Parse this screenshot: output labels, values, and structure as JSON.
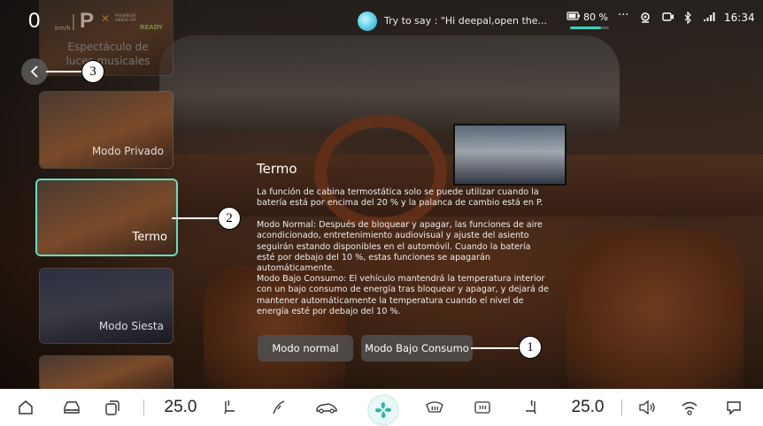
{
  "status_bar": {
    "speed": "0",
    "speed_unit": "km/h",
    "gear": "P",
    "airbag_text": "PASSENGER AIRBAG OFF",
    "ready": "READY",
    "voice_hint": "Try to say : \"Hi deepal,open the...",
    "battery": "80 %",
    "battery_level_percent": 80,
    "more": "···",
    "time": "16:34"
  },
  "sidebar": {
    "items": [
      {
        "label": "Espectáculo de luces musicales"
      },
      {
        "label": "Modo Privado"
      },
      {
        "label": "Termo",
        "selected": true
      },
      {
        "label": "Modo Siesta"
      }
    ]
  },
  "main": {
    "title": "Termo",
    "paragraphs": [
      "La función de cabina termostática solo se puede utilizar cuando la batería está por encima del 20 % y la palanca de cambio está en P.",
      "Modo Normal: Después de bloquear y apagar, las funciones de aire acondicionado, entretenimiento audiovisual y ajuste del asiento seguirán estando disponibles en el automóvil. Cuando la batería esté por debajo del 10 %, estas funciones se apagarán automáticamente.",
      "Modo Bajo Consumo: El vehículo mantendrá la temperatura interior con un bajo consumo de energía tras bloquear y apagar, y dejará de mantener automáticamente la temperatura cuando el nivel de energía esté por debajo del 10 %."
    ],
    "buttons": {
      "normal": "Modo normal",
      "low": "Modo Bajo Consumo"
    }
  },
  "callouts": [
    "1",
    "2",
    "3"
  ],
  "dock": {
    "temp_left": "25.0",
    "temp_right": "25.0"
  },
  "colors": {
    "accent": "#5ee0c8",
    "ready": "#7ad04a",
    "fan": "#2ab8a8"
  }
}
